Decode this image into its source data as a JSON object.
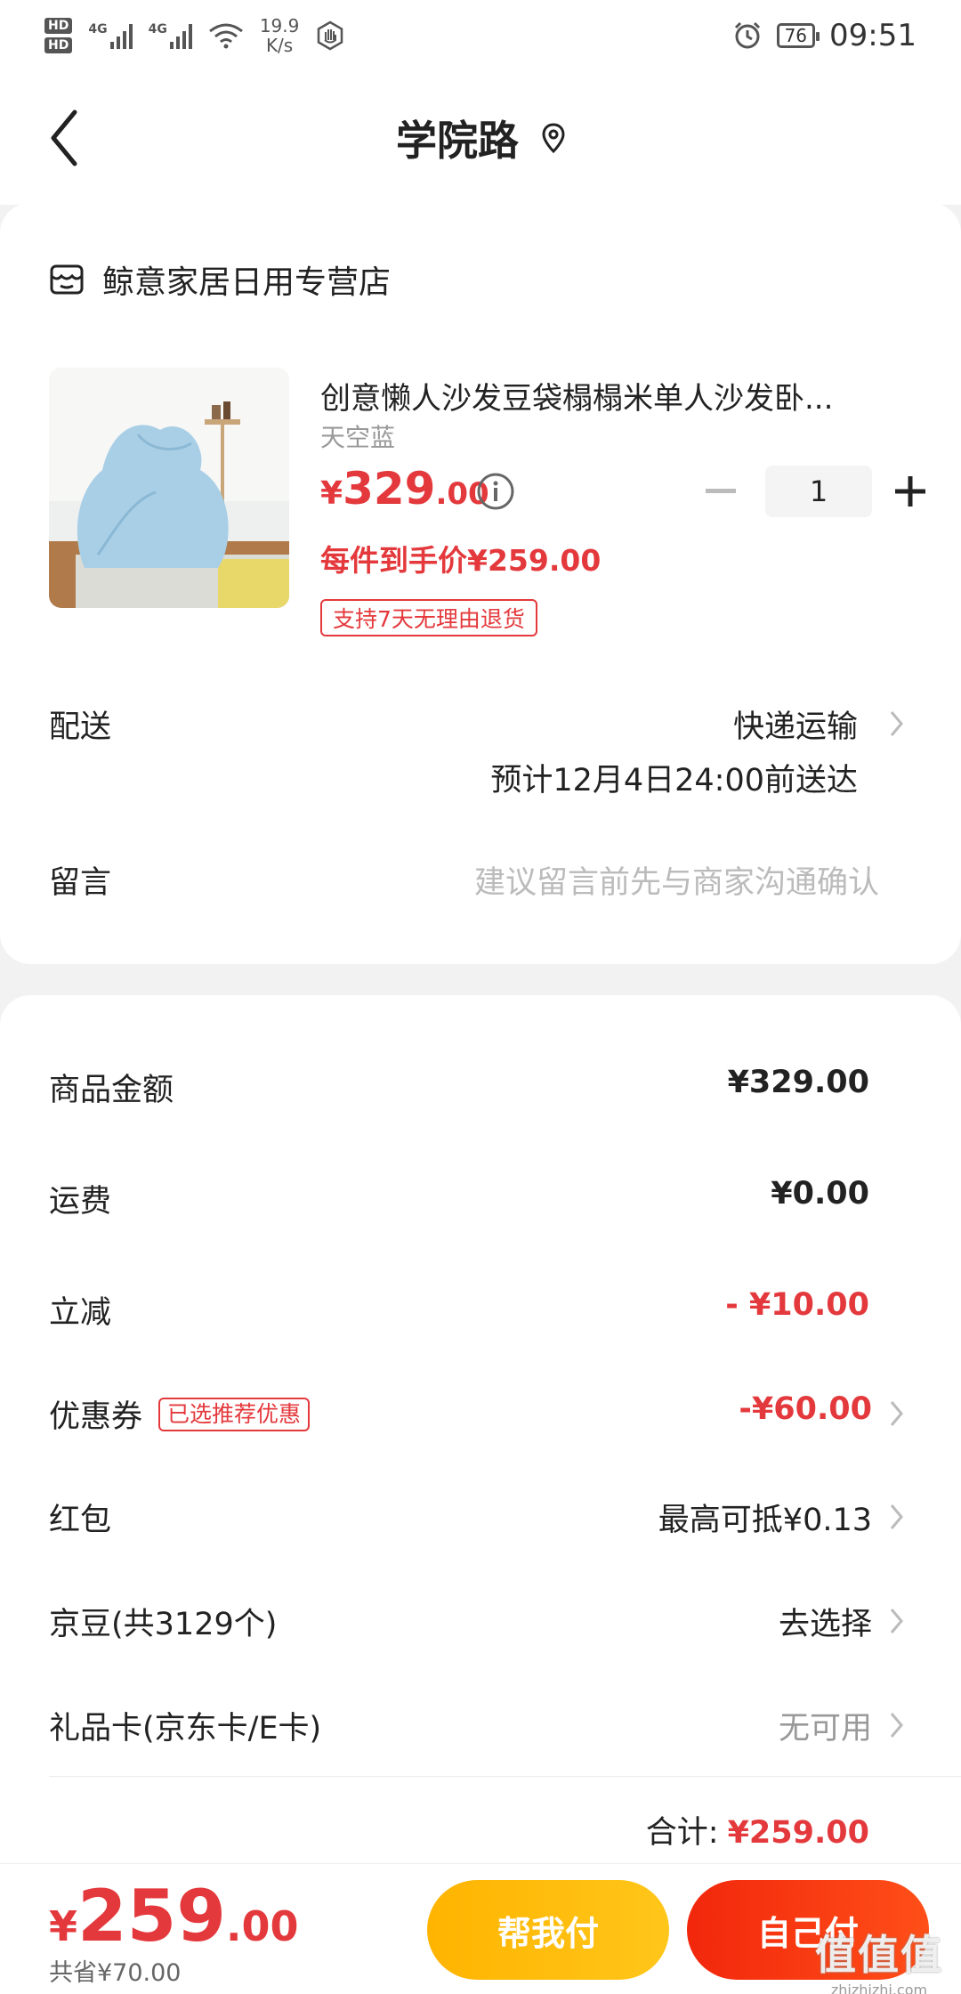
{
  "status_bar": {
    "hd1": "HD",
    "hd2": "HD",
    "net1": "4G",
    "net2": "4G",
    "speed_value": "19.9",
    "speed_unit": "K/s",
    "battery": "76",
    "time": "09:51"
  },
  "nav": {
    "title": "学院路"
  },
  "shop": {
    "name": "鲸意家居日用专营店"
  },
  "product": {
    "title": "创意懒人沙发豆袋榻榻米单人沙发卧...",
    "variant": "天空蓝",
    "price_currency": "¥",
    "price_int": "329",
    "price_dec": ".00",
    "quantity": "1",
    "unit_price_label": "每件到手价¥259.00",
    "return_tag": "支持7天无理由退货"
  },
  "delivery": {
    "label": "配送",
    "method": "快递运输",
    "eta": "预计12月4日24:00前送达"
  },
  "note": {
    "label": "留言",
    "placeholder": "建议留言前先与商家沟通确认"
  },
  "summary": {
    "goods_label": "商品金额",
    "goods_value": "¥329.00",
    "shipping_label": "运费",
    "shipping_value": "¥0.00",
    "discount_label": "立减",
    "discount_value": "- ¥10.00",
    "coupon_label": "优惠券",
    "coupon_badge": "已选推荐优惠",
    "coupon_value": "-¥60.00",
    "redpacket_label": "红包",
    "redpacket_value": "最高可抵¥0.13",
    "jingdou_label": "京豆(共3129个)",
    "jingdou_value": "去选择",
    "giftcard_label": "礼品卡(京东卡/E卡)",
    "giftcard_value": "无可用",
    "total_label": "合计:",
    "total_value": "¥259.00"
  },
  "bottom": {
    "currency": "¥",
    "price_int": "259",
    "price_dec": ".00",
    "saved": "共省¥70.00",
    "help_pay": "帮我付",
    "self_pay": "自己付"
  },
  "watermark": {
    "logo": "值值值",
    "url": "zhizhizhi.com"
  },
  "colors": {
    "accent_red": "#e4393c",
    "help_button": "#ffb400",
    "self_button": "#f2270c"
  }
}
